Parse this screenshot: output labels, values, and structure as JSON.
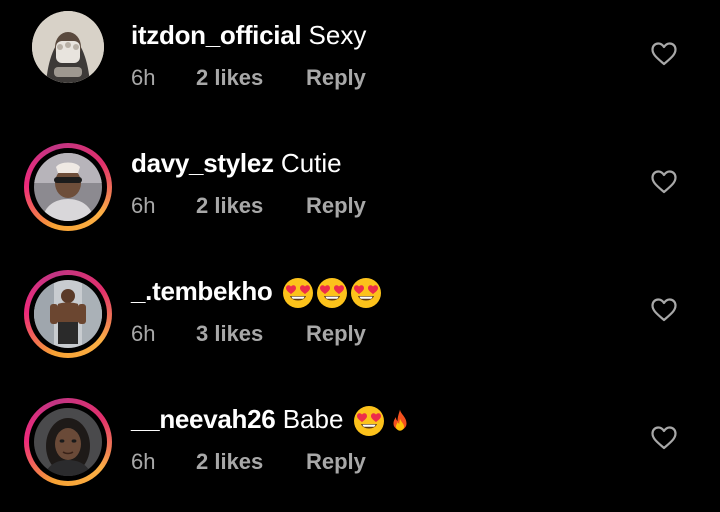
{
  "comments": [
    {
      "username": "itzdon_official",
      "text": "Sexy",
      "time": "6h",
      "likes": "2 likes",
      "reply": "Reply",
      "story_ring": false,
      "emojis": []
    },
    {
      "username": "davy_stylez",
      "text": "Cutie",
      "time": "6h",
      "likes": "2 likes",
      "reply": "Reply",
      "story_ring": true,
      "emojis": []
    },
    {
      "username": "_.tembekho",
      "text": "",
      "time": "6h",
      "likes": "3 likes",
      "reply": "Reply",
      "story_ring": true,
      "emojis": [
        "heart-eyes-emoji",
        "heart-eyes-emoji",
        "heart-eyes-emoji"
      ]
    },
    {
      "username": "__neevah26",
      "text": "Babe",
      "time": "6h",
      "likes": "2 likes",
      "reply": "Reply",
      "story_ring": true,
      "emojis": [
        "heart-eyes-emoji",
        "fire-emoji"
      ]
    }
  ],
  "colors": {
    "background": "#000000",
    "text": "#ffffff",
    "meta_text": "#a8a8a8",
    "ring_orange": "#f7a234",
    "ring_pink": "#ee2a7b"
  }
}
